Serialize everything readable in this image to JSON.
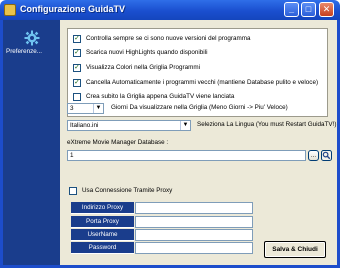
{
  "window": {
    "title": "Configurazione GuidaTV",
    "min_label": "_",
    "max_label": "□",
    "close_label": "✕"
  },
  "sidebar": {
    "icon": "gear-icon",
    "item_label": "Preferenze..."
  },
  "options": [
    {
      "label": "Controlla sempre se ci sono nuove versioni del programma",
      "checked": true
    },
    {
      "label": "Scarica nuovi HighLights quando disponibili",
      "checked": true
    },
    {
      "label": "Visualizza Colori nella Griglia Programmi",
      "checked": true
    },
    {
      "label": "Cancella Automaticamente i programmi vecchi (mantiene Database pulito e veloce)",
      "checked": true
    },
    {
      "label": "Crea subito la Griglia appena GuidaTV viene lanciata",
      "checked": false
    }
  ],
  "days": {
    "value": "3",
    "label": "Giorni Da visualizzare nella Griglia (Meno Giorni -> Piu' Veloce)"
  },
  "language": {
    "value": "Italiano.ini",
    "label": "Seleziona La Lingua (You must Restart GuidaTV!)"
  },
  "database": {
    "label": "eXtreme Movie Manager Database :",
    "value": "1",
    "browse_label": "...",
    "action_icon": "magnifier-icon"
  },
  "proxy": {
    "use_label": "Usa Connessione Tramite  Proxy",
    "use_checked": false,
    "fields": [
      {
        "label": "Indirizzo Proxy",
        "value": ""
      },
      {
        "label": "Porta Proxy",
        "value": ""
      },
      {
        "label": "UserName",
        "value": ""
      },
      {
        "label": "Password",
        "value": ""
      }
    ]
  },
  "save_label": "Salva & Chiudi",
  "colors": {
    "titlebar": "#1a4fcf",
    "sidebar": "#1a3d8c",
    "dialog_bg": "#ece9d8"
  }
}
